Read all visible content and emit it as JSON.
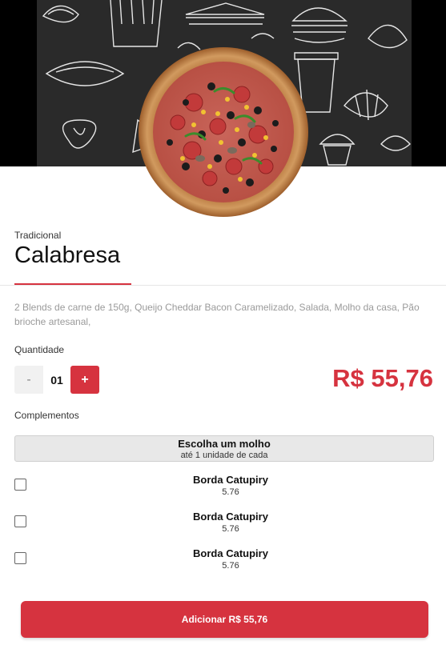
{
  "product": {
    "category": "Tradicional",
    "name": "Calabresa",
    "description": "2 Blends de carne de 150g, Queijo Cheddar Bacon Caramelizado, Salada, Molho da casa, Pão brioche artesanal,",
    "price": "R$ 55,76"
  },
  "quantity": {
    "label": "Quantidade",
    "minus": "-",
    "value": "01",
    "plus": "+"
  },
  "complements": {
    "label": "Complementos",
    "group_title": "Escolha um molho",
    "group_subtitle": "até 1 unidade de cada",
    "options": [
      {
        "name": "Borda Catupiry",
        "price": "5.76"
      },
      {
        "name": "Borda Catupiry",
        "price": "5.76"
      },
      {
        "name": "Borda Catupiry",
        "price": "5.76"
      }
    ]
  },
  "add_button": {
    "label": "Adicionar R$ 55,76"
  },
  "colors": {
    "accent": "#d6333f",
    "hero_bg": "#2a2a2a"
  },
  "icons": {
    "hero": "food-doodle-pattern",
    "product": "pizza-image"
  }
}
